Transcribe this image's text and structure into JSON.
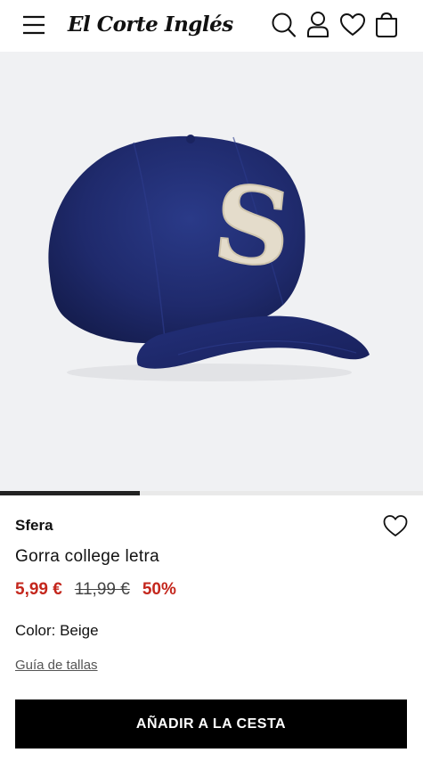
{
  "header": {
    "logo_text": "El Corte Inglés",
    "icons": [
      "menu-icon",
      "search-icon",
      "user-icon",
      "heart-icon",
      "bag-icon"
    ]
  },
  "gallery": {
    "image_subject": "navy wool baseball cap with beige embroidered letter S",
    "cap_color": "#1f2a66",
    "letter_color": "#e4dccb",
    "letter": "S",
    "background": "#f0f1f3",
    "position": 0.33
  },
  "product": {
    "brand": "Sfera",
    "title": "Gorra college letra",
    "price_current": "5,99 €",
    "price_old": "11,99 €",
    "discount": "50%",
    "color_label": "Color: Beige",
    "size_guide": "Guía de tallas",
    "add_to_cart": "AÑADIR A LA CESTA"
  },
  "colors": {
    "sale_red": "#c4271d",
    "button_bg": "#000000",
    "button_text": "#ffffff"
  }
}
